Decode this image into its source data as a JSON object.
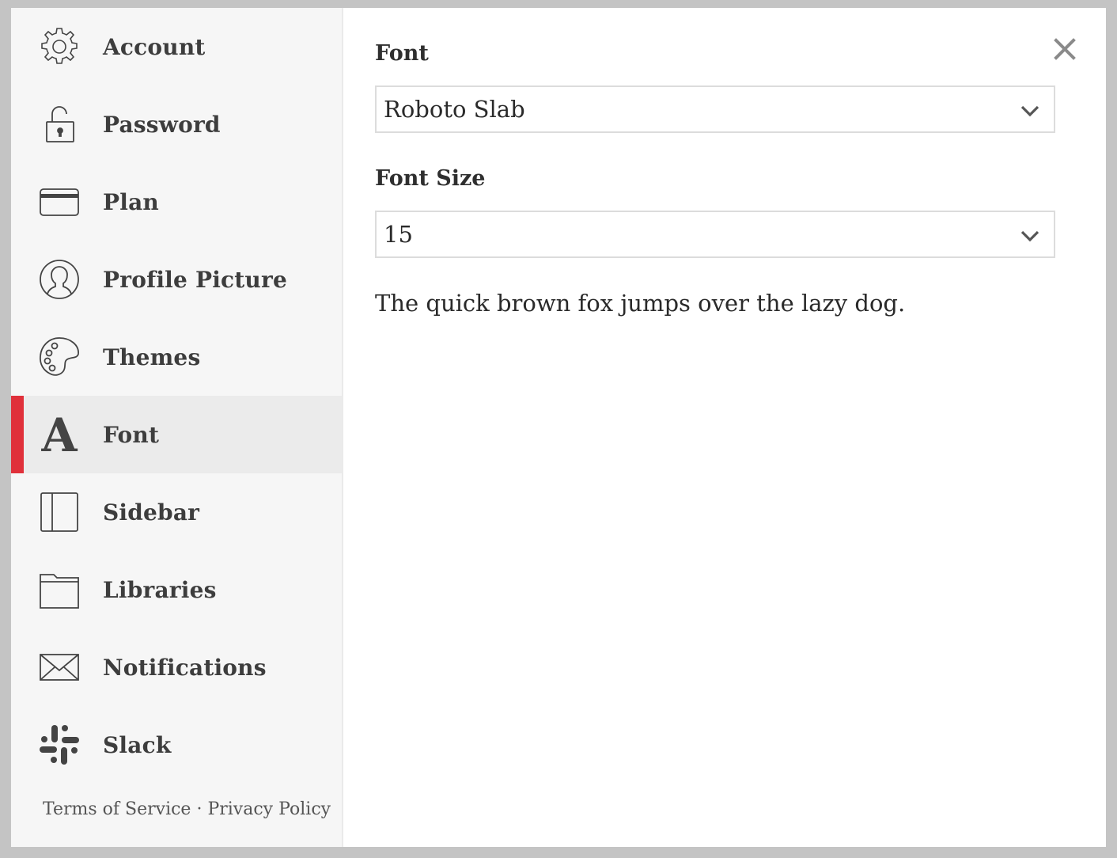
{
  "sidebar": {
    "items": [
      {
        "label": "Account",
        "icon": "gear-icon"
      },
      {
        "label": "Password",
        "icon": "unlock-icon"
      },
      {
        "label": "Plan",
        "icon": "credit-card-icon"
      },
      {
        "label": "Profile Picture",
        "icon": "user-circle-icon"
      },
      {
        "label": "Themes",
        "icon": "palette-icon"
      },
      {
        "label": "Font",
        "icon": "font-icon"
      },
      {
        "label": "Sidebar",
        "icon": "sidebar-icon"
      },
      {
        "label": "Libraries",
        "icon": "folder-icon"
      },
      {
        "label": "Notifications",
        "icon": "envelope-icon"
      },
      {
        "label": "Slack",
        "icon": "slack-icon"
      }
    ],
    "active_item": "Font",
    "footer": {
      "terms": "Terms of Service",
      "separator": "·",
      "privacy": "Privacy Policy"
    }
  },
  "main": {
    "font_label": "Font",
    "font_value": "Roboto Slab",
    "font_size_label": "Font Size",
    "font_size_value": "15",
    "preview_text": "The quick brown fox jumps over the lazy dog."
  },
  "colors": {
    "accent": "#e0303a",
    "sidebar_bg": "#f6f6f6",
    "active_bg": "#ebebeb",
    "backdrop": "#c4c4c4"
  }
}
